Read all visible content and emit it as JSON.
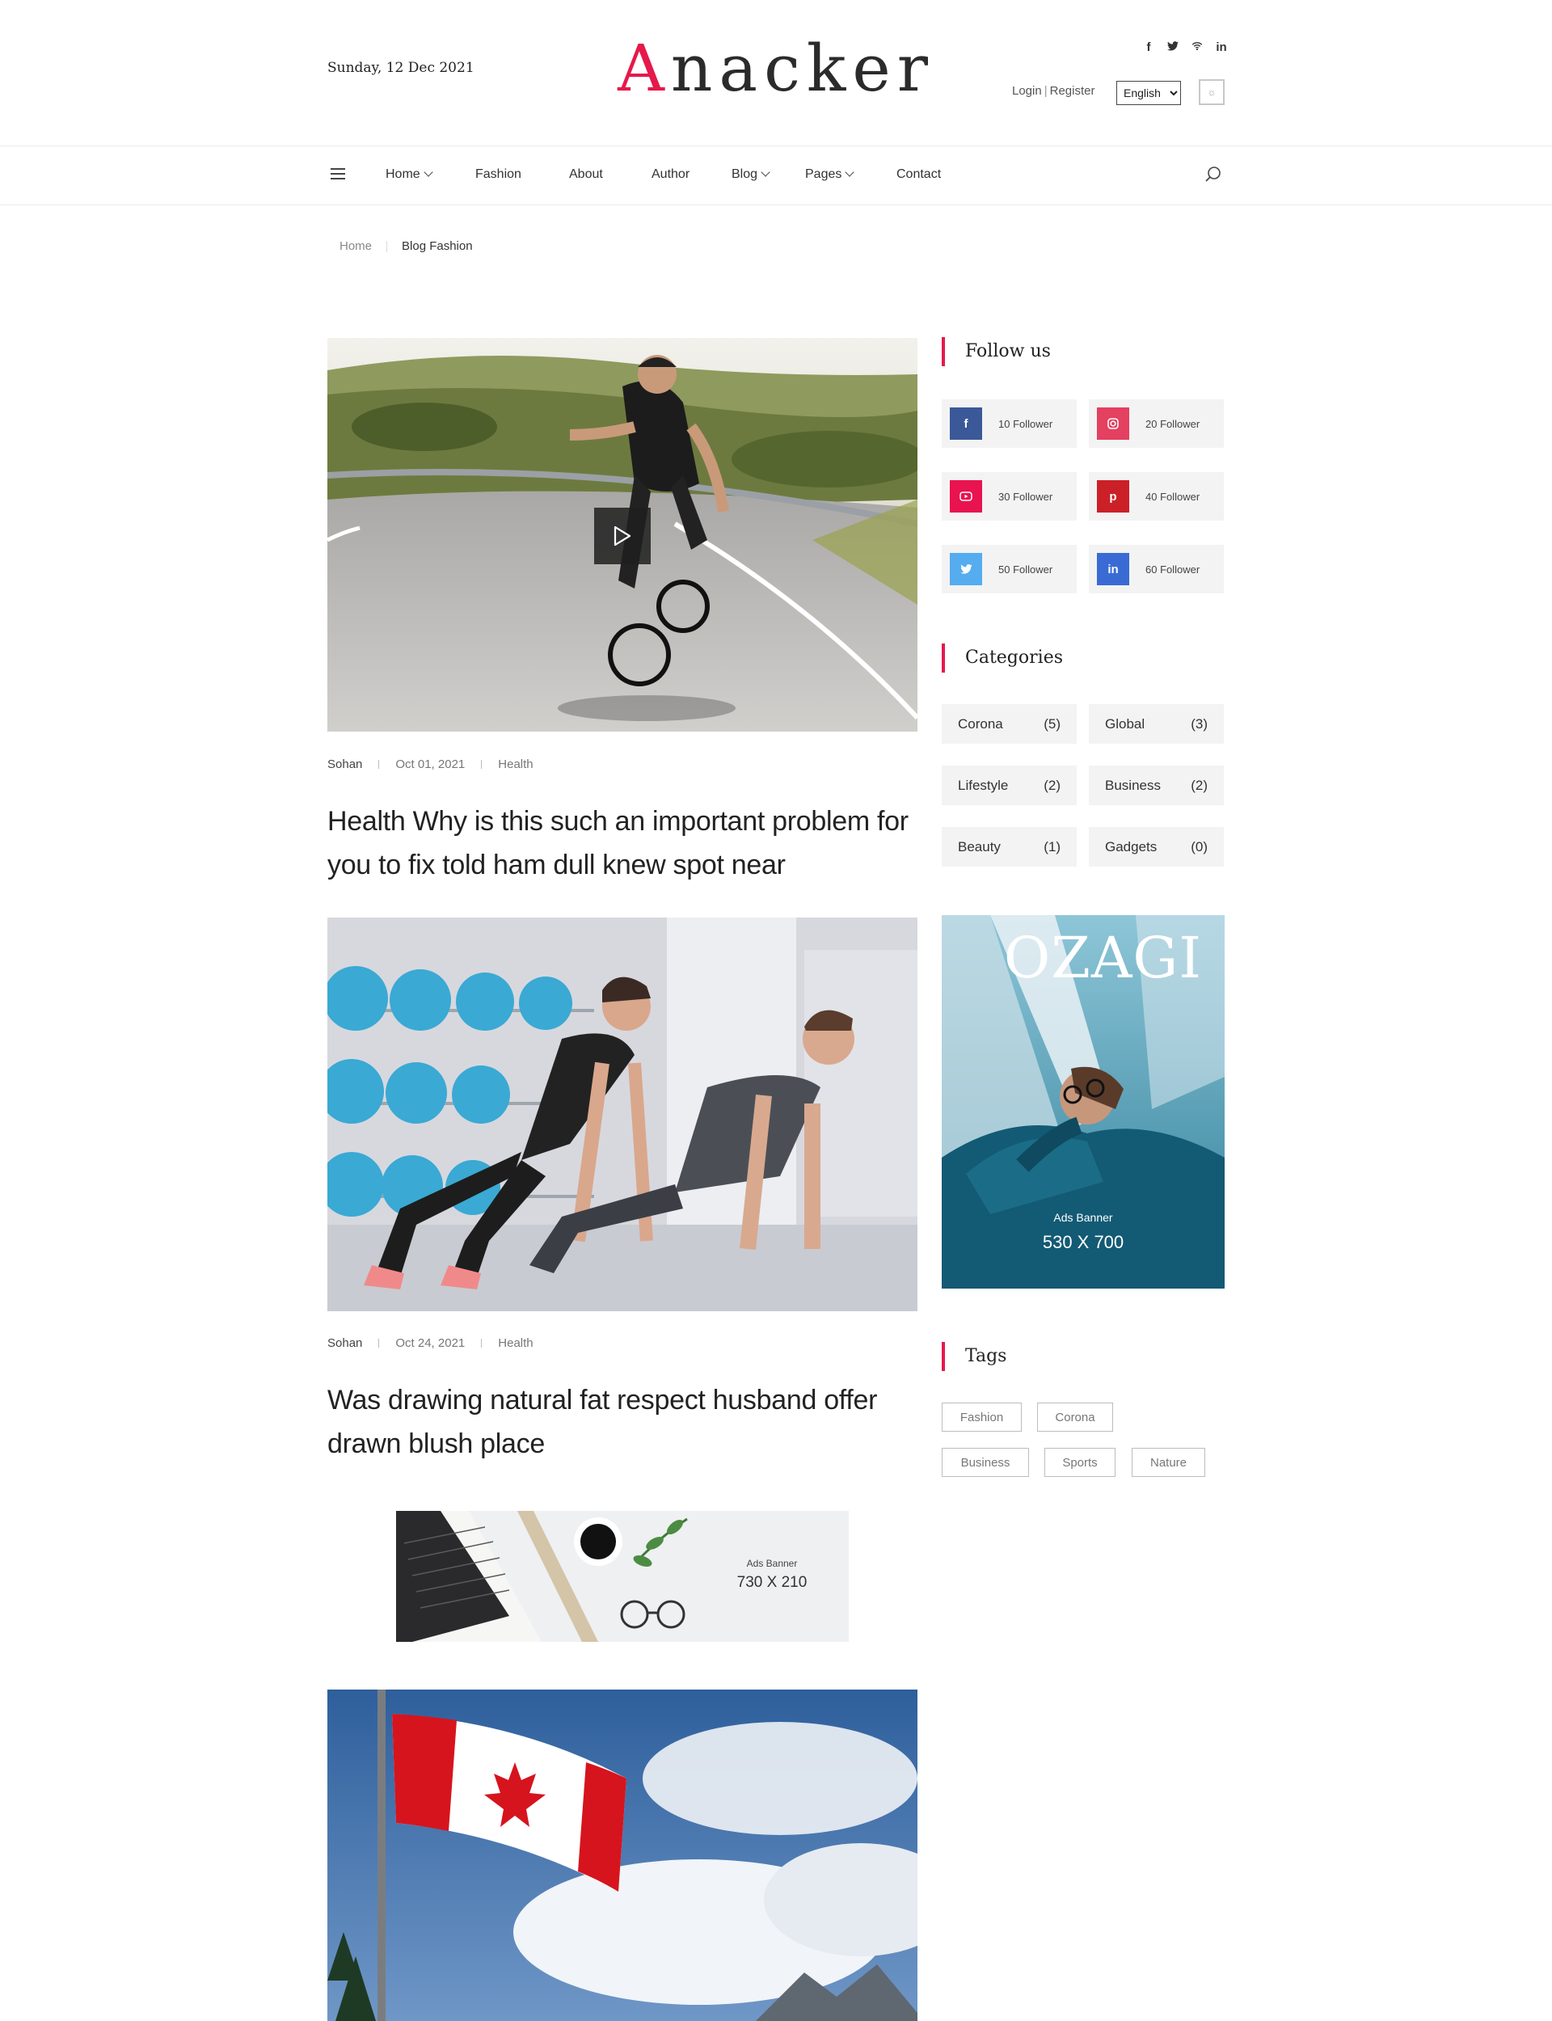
{
  "header": {
    "date": "Sunday, 12 Dec 2021",
    "logo": "Anacker",
    "login": "Login",
    "register": "Register",
    "language": "English",
    "social_icons": [
      "facebook-icon",
      "twitter-icon",
      "wifi-icon",
      "linkedin-icon"
    ]
  },
  "nav": {
    "items": [
      {
        "label": "Home",
        "dropdown": true
      },
      {
        "label": "Fashion",
        "dropdown": false
      },
      {
        "label": "About",
        "dropdown": false
      },
      {
        "label": "Author",
        "dropdown": false
      },
      {
        "label": "Blog",
        "dropdown": true
      },
      {
        "label": "Pages",
        "dropdown": true
      },
      {
        "label": "Contact",
        "dropdown": false
      }
    ]
  },
  "breadcrumb": {
    "home": "Home",
    "current": "Blog Fashion"
  },
  "posts": [
    {
      "author": "Sohan",
      "date": "Oct 01, 2021",
      "category": "Health",
      "title": "Health Why is this such an important problem for you to fix told ham dull knew spot near",
      "has_video": true
    },
    {
      "author": "Sohan",
      "date": "Oct 24, 2021",
      "category": "Health",
      "title": "Was drawing natural fat respect husband offer drawn blush place",
      "has_video": false
    }
  ],
  "ad_wide": {
    "label": "Ads Banner",
    "size": "730 X 210"
  },
  "sidebar": {
    "follow_title": "Follow us",
    "follow": [
      {
        "network": "facebook",
        "icon": "facebook-icon",
        "text": "10 Follower",
        "color": "#3b5998"
      },
      {
        "network": "instagram",
        "icon": "instagram-icon",
        "text": "20 Follower",
        "color": "#e4405f"
      },
      {
        "network": "youtube",
        "icon": "youtube-icon",
        "text": "30 Follower",
        "color": "#e8134f"
      },
      {
        "network": "pinterest",
        "icon": "pinterest-icon",
        "text": "40 Follower",
        "color": "#cb2027"
      },
      {
        "network": "twitter",
        "icon": "twitter-icon",
        "text": "50 Follower",
        "color": "#55acee"
      },
      {
        "network": "linkedin",
        "icon": "linkedin-icon",
        "text": "60 Follower",
        "color": "#3a6bd4"
      }
    ],
    "categories_title": "Categories",
    "categories": [
      {
        "name": "Corona",
        "count": "(5)"
      },
      {
        "name": "Global",
        "count": "(3)"
      },
      {
        "name": "Lifestyle",
        "count": "(2)"
      },
      {
        "name": "Business",
        "count": "(2)"
      },
      {
        "name": "Beauty",
        "count": "(1)"
      },
      {
        "name": "Gadgets",
        "count": "(0)"
      }
    ],
    "ad": {
      "brand": "OZAGI",
      "label": "Ads Banner",
      "size": "530 X 700"
    },
    "tags_title": "Tags",
    "tags": [
      "Fashion",
      "Corona",
      "Business",
      "Sports",
      "Nature"
    ]
  },
  "colors": {
    "accent": "#e5194b"
  }
}
